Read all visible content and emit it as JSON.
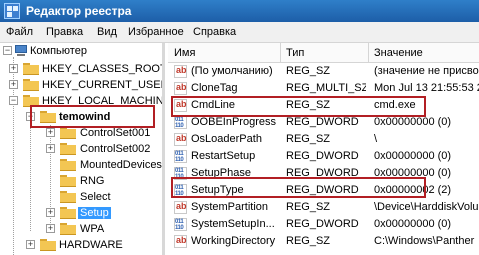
{
  "window": {
    "title": "Редактор реестра",
    "icon": "registry-editor-icon"
  },
  "menu": [
    "Файл",
    "Правка",
    "Вид",
    "Избранное",
    "Справка"
  ],
  "tree": {
    "root": "Компьютер",
    "items": [
      {
        "label": "HKEY_CLASSES_ROOT"
      },
      {
        "label": "HKEY_CURRENT_USER"
      },
      {
        "label": "HKEY_LOCAL_MACHINE"
      },
      {
        "label": "temowind",
        "highlighted": true
      },
      {
        "label": "ControlSet001"
      },
      {
        "label": "ControlSet002"
      },
      {
        "label": "MountedDevices"
      },
      {
        "label": "RNG"
      },
      {
        "label": "Select"
      },
      {
        "label": "Setup",
        "selected": true
      },
      {
        "label": "WPA"
      },
      {
        "label": "HARDWARE"
      }
    ]
  },
  "list": {
    "columns": [
      "Имя",
      "Тип",
      "Значение"
    ],
    "rows": [
      {
        "name": "(По умолчанию)",
        "type": "REG_SZ",
        "value": "(значение не присво",
        "icon": "string-value-icon"
      },
      {
        "name": "CloneTag",
        "type": "REG_MULTI_SZ",
        "value": "Mon Jul 13 21:55:53 2",
        "icon": "string-value-icon"
      },
      {
        "name": "CmdLine",
        "type": "REG_SZ",
        "value": "cmd.exe",
        "icon": "string-value-icon",
        "highlighted": true
      },
      {
        "name": "OOBEInProgress",
        "type": "REG_DWORD",
        "value": "0x00000000 (0)",
        "icon": "binary-value-icon"
      },
      {
        "name": "OsLoaderPath",
        "type": "REG_SZ",
        "value": "\\",
        "icon": "string-value-icon"
      },
      {
        "name": "RestartSetup",
        "type": "REG_DWORD",
        "value": "0x00000000 (0)",
        "icon": "binary-value-icon"
      },
      {
        "name": "SetupPhase",
        "type": "REG_DWORD",
        "value": "0x00000000 (0)",
        "icon": "binary-value-icon"
      },
      {
        "name": "SetupType",
        "type": "REG_DWORD",
        "value": "0x00000002 (2)",
        "icon": "binary-value-icon",
        "highlighted": true
      },
      {
        "name": "SystemPartition",
        "type": "REG_SZ",
        "value": "\\Device\\HarddiskVolu",
        "icon": "string-value-icon"
      },
      {
        "name": "SystemSetupIn...",
        "type": "REG_DWORD",
        "value": "0x00000000 (0)",
        "icon": "binary-value-icon"
      },
      {
        "name": "WorkingDirectory",
        "type": "REG_SZ",
        "value": "C:\\Windows\\Panther",
        "icon": "string-value-icon"
      }
    ]
  },
  "colors": {
    "highlight": "#b21f24",
    "selection": "#3399ff",
    "title_bar": "#2f7fc9"
  }
}
